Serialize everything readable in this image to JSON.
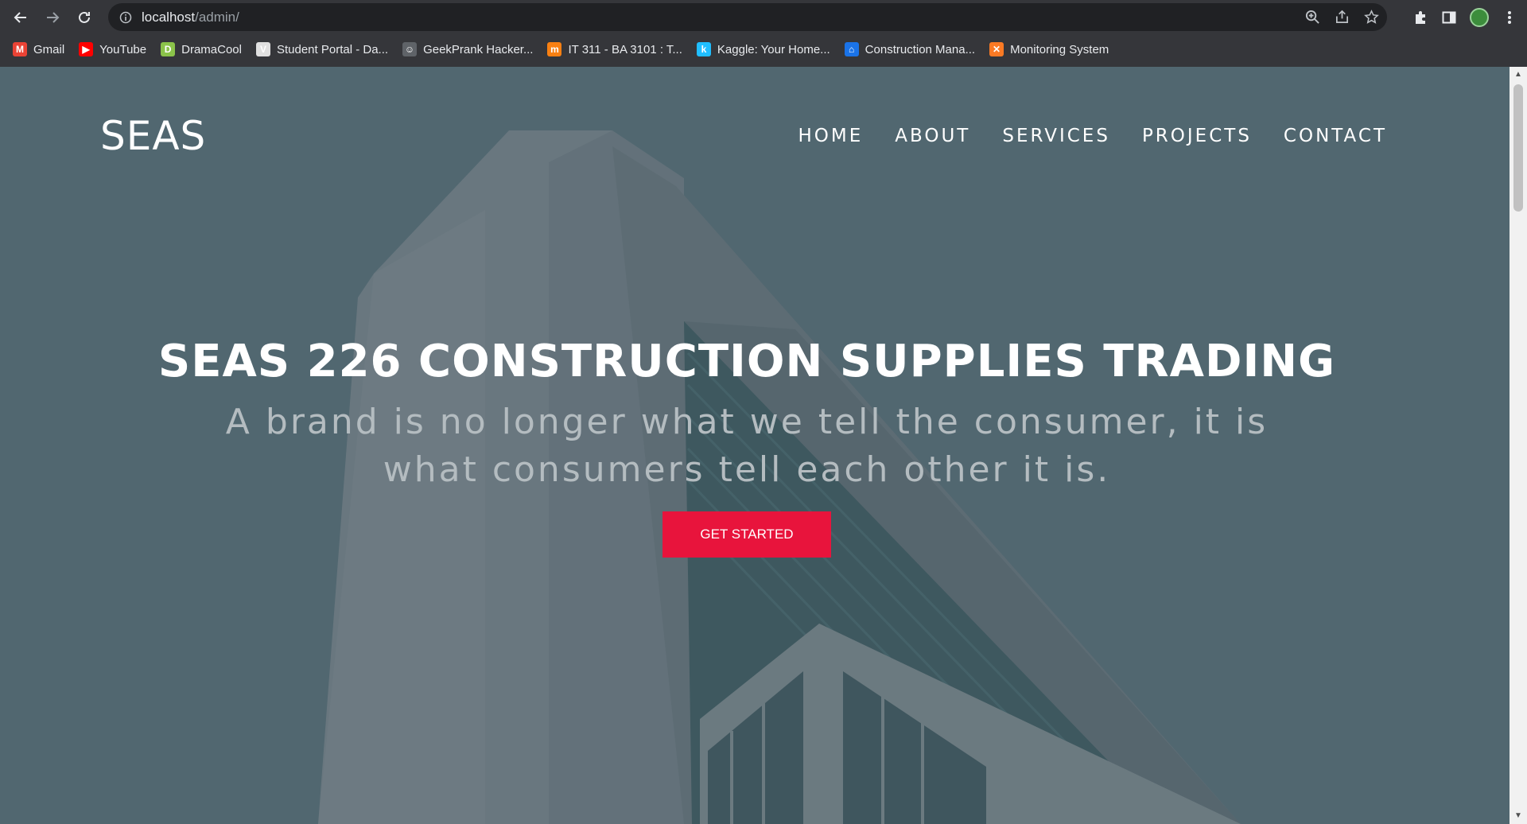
{
  "browser": {
    "url_host": "localhost",
    "url_path": "/admin/",
    "bookmarks": [
      {
        "label": "Gmail",
        "icon": "gmail-icon",
        "color": "#ea4335",
        "glyph": "M"
      },
      {
        "label": "YouTube",
        "icon": "youtube-icon",
        "color": "#ff0000",
        "glyph": "▶"
      },
      {
        "label": "DramaCool",
        "icon": "dramacool-icon",
        "color": "#8bc34a",
        "glyph": "D"
      },
      {
        "label": "Student Portal - Da...",
        "icon": "student-portal-icon",
        "color": "#e0e0e0",
        "glyph": "V"
      },
      {
        "label": "GeekPrank Hacker...",
        "icon": "geekprank-icon",
        "color": "#5f6368",
        "glyph": "☺"
      },
      {
        "label": "IT 311 - BA 3101 : T...",
        "icon": "moodle-icon",
        "color": "#f98012",
        "glyph": "m"
      },
      {
        "label": "Kaggle: Your Home...",
        "icon": "kaggle-icon",
        "color": "#20beff",
        "glyph": "k"
      },
      {
        "label": "Construction Mana...",
        "icon": "construction-icon",
        "color": "#1a73e8",
        "glyph": "⌂"
      },
      {
        "label": "Monitoring System",
        "icon": "xampp-icon",
        "color": "#fb7a24",
        "glyph": "✕"
      }
    ]
  },
  "site": {
    "brand": "SEAS",
    "menu": [
      "HOME",
      "ABOUT",
      "SERVICES",
      "PROJECTS",
      "CONTACT"
    ],
    "hero_title": "SEAS 226 CONSTRUCTION SUPPLIES TRADING",
    "hero_subtitle": "A brand is no longer what we tell the consumer, it is what consumers tell each other it is.",
    "cta_label": "GET STARTED",
    "accent": "#e8143c",
    "overlay": "#546a72"
  }
}
